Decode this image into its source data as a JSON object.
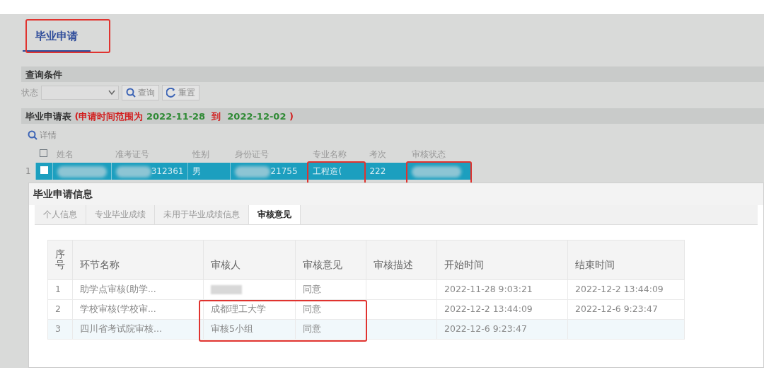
{
  "page_tab": {
    "label": "毕业申请",
    "selected": true,
    "annotated": true
  },
  "query_panel": {
    "title": "查询条件",
    "status_label": "状态",
    "buttons": [
      {
        "kind": "search",
        "label": "查询"
      },
      {
        "kind": "reset",
        "label": "重置"
      }
    ]
  },
  "list_panel": {
    "title": "毕业申请表",
    "range_open": "(申请时间范围为",
    "range_start": "2022-11-28",
    "range_mid": "到",
    "range_end": "2022-12-02",
    "range_close": ")",
    "detail_button": "详情",
    "select_all_checked": false,
    "columns": [
      "姓名",
      "准考证号",
      "性别",
      "身份证号",
      "专业名称",
      "考次",
      "审核状态"
    ],
    "rows": [
      {
        "index": "1",
        "selected": true,
        "checked": false,
        "cells": [
          {
            "text": "",
            "redacted": true
          },
          {
            "text": "312361",
            "redacted": true
          },
          {
            "text": "男"
          },
          {
            "text": "21755",
            "redacted": true
          },
          {
            "text": "工程造(",
            "annotated": true
          },
          {
            "text": "222"
          },
          {
            "text": "",
            "redacted": true,
            "annotated": true
          }
        ]
      }
    ]
  },
  "dialog": {
    "title": "毕业申请信息",
    "tabs": [
      {
        "label": "个人信息",
        "selected": false
      },
      {
        "label": "专业毕业成绩",
        "selected": false
      },
      {
        "label": "未用于毕业成绩信息",
        "selected": false
      },
      {
        "label": "审核意见",
        "selected": true
      }
    ],
    "columns": [
      "序号",
      "环节名称",
      "审核人",
      "审核意见",
      "审核描述",
      "开始时间",
      "结束时间"
    ],
    "rows": [
      {
        "cells": [
          {
            "text": "1"
          },
          {
            "text": "助学点审核(助学..."
          },
          {
            "text": "",
            "redacted": true
          },
          {
            "text": "同意"
          },
          {
            "text": ""
          },
          {
            "text": "2022-11-28 9:03:21"
          },
          {
            "text": "2022-12-2 13:44:09"
          }
        ]
      },
      {
        "cells": [
          {
            "text": "2"
          },
          {
            "text": "学校审核(学校审..."
          },
          {
            "text": "成都理工大学",
            "annotated": true
          },
          {
            "text": "同意",
            "annotated": true
          },
          {
            "text": ""
          },
          {
            "text": "2022-12-2 13:44:09"
          },
          {
            "text": "2022-12-6 9:23:47"
          }
        ]
      },
      {
        "cells": [
          {
            "text": "3"
          },
          {
            "text": "四川省考试院审核..."
          },
          {
            "text": "审核5小组",
            "annotated": true
          },
          {
            "text": "同意",
            "annotated": true
          },
          {
            "text": ""
          },
          {
            "text": "2022-12-6 9:23:47"
          },
          {
            "text": ""
          }
        ]
      }
    ]
  }
}
